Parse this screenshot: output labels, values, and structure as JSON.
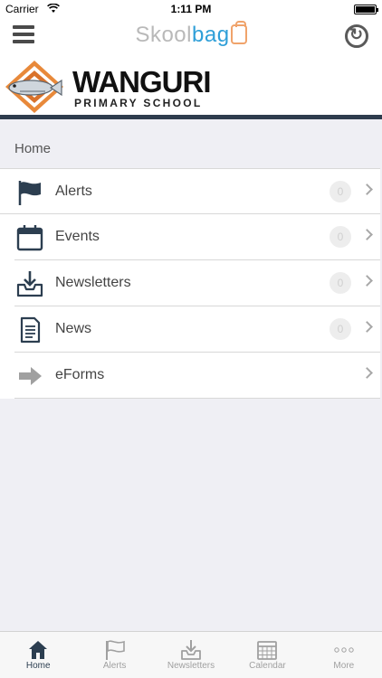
{
  "status_bar": {
    "carrier": "Carrier",
    "time": "1:11 PM"
  },
  "nav": {
    "brand_part1": "Skool",
    "brand_part2": "bag",
    "menu_icon": "hamburger-menu-icon",
    "sync_icon": "sync-icon"
  },
  "banner": {
    "school_name": "WANGURI",
    "school_subtitle": "PRIMARY SCHOOL"
  },
  "section_title": "Home",
  "menu_items": [
    {
      "label": "Alerts",
      "icon": "flag-icon",
      "badge": "0"
    },
    {
      "label": "Events",
      "icon": "calendar-icon",
      "badge": "0"
    },
    {
      "label": "Newsletters",
      "icon": "inbox-download-icon",
      "badge": "0"
    },
    {
      "label": "News",
      "icon": "document-icon",
      "badge": "0"
    },
    {
      "label": "eForms",
      "icon": "arrow-right-icon"
    }
  ],
  "tabs": [
    {
      "label": "Home",
      "icon": "home-icon",
      "active": true
    },
    {
      "label": "Alerts",
      "icon": "flag-icon",
      "active": false
    },
    {
      "label": "Newsletters",
      "icon": "inbox-download-icon",
      "active": false
    },
    {
      "label": "Calendar",
      "icon": "calendar-grid-icon",
      "active": false
    },
    {
      "label": "More",
      "icon": "more-dots-icon",
      "active": false
    }
  ],
  "colors": {
    "brand_grey": "#b9b9b9",
    "brand_blue": "#2f9fd8",
    "bag_orange": "#f0a36b",
    "banner_rule": "#2e3c4d",
    "active_tab": "#2c3e50"
  }
}
